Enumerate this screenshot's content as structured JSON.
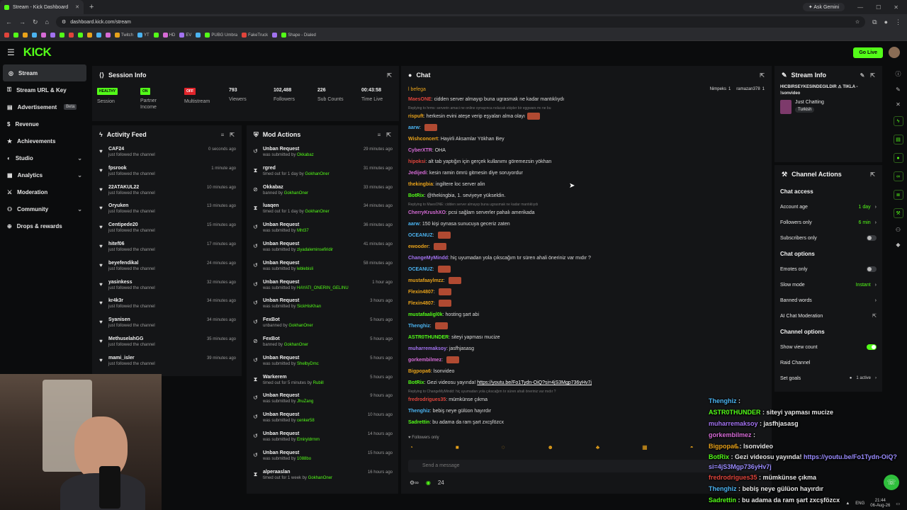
{
  "browser": {
    "tab_title": "Stream - Kick Dashboard",
    "new_tab": "+",
    "ask_gemini": "Ask Gemini",
    "url": "dashboard.kick.com/stream",
    "bookmarks": [
      "Twitch",
      "YT",
      "HD",
      "EV",
      "PUBG Umbra",
      "FakeTruck",
      "Shape - Dialed"
    ]
  },
  "header": {
    "logo": "KICK",
    "go_live": "Go Live"
  },
  "sidebar": {
    "items": [
      {
        "label": "Stream",
        "icon": "stream-icon",
        "active": true
      },
      {
        "label": "Stream URL & Key",
        "icon": "key-icon"
      },
      {
        "label": "Advertisement",
        "icon": "megaphone-icon",
        "badge": "Beta"
      },
      {
        "label": "Revenue",
        "icon": "dollar-icon"
      },
      {
        "label": "Achievements",
        "icon": "trophy-icon"
      },
      {
        "label": "Studio",
        "icon": "studio-icon",
        "expand": true
      },
      {
        "label": "Analytics",
        "icon": "chart-icon",
        "expand": true
      },
      {
        "label": "Moderation",
        "icon": "sword-icon"
      },
      {
        "label": "Community",
        "icon": "users-icon",
        "expand": true
      },
      {
        "label": "Drops & rewards",
        "icon": "gift-icon"
      }
    ]
  },
  "session": {
    "title": "Session Info",
    "stats": [
      {
        "badge": "HEALTHY",
        "label": "Session",
        "color": "#53fc18"
      },
      {
        "badge": "ON",
        "label": "Partner Income",
        "color": "#53fc18"
      },
      {
        "badge": "OFF",
        "label": "Multistream",
        "color": "#e0242b"
      },
      {
        "value": "793",
        "label": "Viewers"
      },
      {
        "value": "102,488",
        "label": "Followers"
      },
      {
        "value": "226",
        "label": "Sub Counts"
      },
      {
        "value": "00:43:58",
        "label": "Time Live"
      }
    ]
  },
  "activity": {
    "title": "Activity Feed",
    "items": [
      {
        "name": "CAF24",
        "sub": "just followed the channel",
        "time": "0 seconds ago"
      },
      {
        "name": "fpsrook",
        "sub": "just followed the channel",
        "time": "1 minute ago"
      },
      {
        "name": "22ATAKUL22",
        "sub": "just followed the channel",
        "time": "10 minutes ago"
      },
      {
        "name": "Oryuken",
        "sub": "just followed the channel",
        "time": "13 minutes ago"
      },
      {
        "name": "Centipede20",
        "sub": "just followed the channel",
        "time": "15 minutes ago"
      },
      {
        "name": "hitef06",
        "sub": "just followed the channel",
        "time": "17 minutes ago"
      },
      {
        "name": "beyefendikal",
        "sub": "just followed the channel",
        "time": "24 minutes ago"
      },
      {
        "name": "yasinkess",
        "sub": "just followed the channel",
        "time": "32 minutes ago"
      },
      {
        "name": "kr4k3r",
        "sub": "just followed the channel",
        "time": "34 minutes ago"
      },
      {
        "name": "Syanisen",
        "sub": "just followed the channel",
        "time": "34 minutes ago"
      },
      {
        "name": "MethuselahGG",
        "sub": "just followed the channel",
        "time": "35 minutes ago"
      },
      {
        "name": "mami_isler",
        "sub": "just followed the channel",
        "time": "39 minutes ago"
      }
    ]
  },
  "mod": {
    "title": "Mod Actions",
    "items": [
      {
        "icon": "↺",
        "name": "Unban Request",
        "pre": "was submitted by ",
        "by": "Okkabaz",
        "time": "29 minutes ago"
      },
      {
        "icon": "⧗",
        "name": "rgred",
        "pre": "timed out for 1 day by ",
        "by": "GokhanOner",
        "time": "31 minutes ago"
      },
      {
        "icon": "⊘",
        "name": "Okkabaz",
        "pre": "banned by ",
        "by": "GokhanOner",
        "time": "33 minutes ago"
      },
      {
        "icon": "⧗",
        "name": "luaqen",
        "pre": "timed out for 1 day by ",
        "by": "GokhanOner",
        "time": "34 minutes ago"
      },
      {
        "icon": "↺",
        "name": "Unban Request",
        "pre": "was submitted by ",
        "by": "Mht37",
        "time": "36 minutes ago"
      },
      {
        "icon": "↺",
        "name": "Unban Request",
        "pre": "was submitted by ",
        "by": "ziyadaleminsefiridir",
        "time": "41 minutes ago"
      },
      {
        "icon": "↺",
        "name": "Unban Request",
        "pre": "was submitted by ",
        "by": "leblebisli",
        "time": "58 minutes ago"
      },
      {
        "icon": "↺",
        "name": "Unban Request",
        "pre": "was submitted by ",
        "by": "HAYATI_ONERIN_GELINU",
        "time": "1 hour ago"
      },
      {
        "icon": "↺",
        "name": "Unban Request",
        "pre": "was submitted by ",
        "by": "SickHisKhan",
        "time": "3 hours ago"
      },
      {
        "icon": "↺",
        "name": "FexBot",
        "pre": "unbanned by ",
        "by": "GokhanOner",
        "time": "5 hours ago"
      },
      {
        "icon": "⊘",
        "name": "FexBot",
        "pre": "banned by ",
        "by": "GokhanOner",
        "time": "5 hours ago"
      },
      {
        "icon": "↺",
        "name": "Unban Request",
        "pre": "was submitted by ",
        "by": "ShelbyDmc",
        "time": "5 hours ago"
      },
      {
        "icon": "⧗",
        "name": "Warkerem",
        "pre": "timed out for 5 minutes by ",
        "by": "Rubill",
        "time": "5 hours ago"
      },
      {
        "icon": "↺",
        "name": "Unban Request",
        "pre": "was submitted by ",
        "by": "JhuZang",
        "time": "9 hours ago"
      },
      {
        "icon": "↺",
        "name": "Unban Request",
        "pre": "was submitted by ",
        "by": "cenker58",
        "time": "10 hours ago"
      },
      {
        "icon": "↺",
        "name": "Unban Request",
        "pre": "was submitted by ",
        "by": "Emiryldrmm",
        "time": "14 hours ago"
      },
      {
        "icon": "↺",
        "name": "Unban Request",
        "pre": "was submitted by ",
        "by": "1088bo",
        "time": "15 hours ago"
      },
      {
        "icon": "⧗",
        "name": "alperaaslan",
        "pre": "timed out for 1 week by ",
        "by": "GokhanOner",
        "time": "16 hours ago"
      }
    ]
  },
  "chat": {
    "title": "Chat",
    "pinned_user": "l befega",
    "top_users": [
      {
        "name": "Nimpeks",
        "n": "1"
      },
      {
        "name": "ramazan378",
        "n": "1"
      }
    ],
    "messages": [
      {
        "type": "msg",
        "user": "MaesONE",
        "color": "#e0443b",
        "text": "cidden server almayıp buna ugrasmak ne kadar mantıklıydı"
      },
      {
        "type": "reply",
        "text": "Replying to hrms: serverin amaci ne online oynayınca nolucak ekipler bir eggwars mı ne bu"
      },
      {
        "type": "msg",
        "user": "rispuft",
        "color": "#e8a21a",
        "text": "herkesin evini ateşe verip eşyaları alma olayı",
        "emote": true
      },
      {
        "type": "msg",
        "user": "aarw",
        "color": "#4bb3f0",
        "text": "",
        "emote": true
      },
      {
        "type": "msg",
        "user": "Wishconcert",
        "color": "#e8a21a",
        "text": "Hayirli Aksamlar Yökhan Bey"
      },
      {
        "type": "msg",
        "user": "CyberXTR",
        "color": "#d66bd6",
        "text": "OHA"
      },
      {
        "type": "msg",
        "user": "hipoksi",
        "color": "#e0443b",
        "text": "alt tab yaptığın için gerçek kullanımı göremezsin yökhan"
      },
      {
        "type": "msg",
        "user": "Jedijedi",
        "color": "#d66bd6",
        "text": "kesin ramin ömrü gitmesin diye soruyordur"
      },
      {
        "type": "msg",
        "user": "thekingbia",
        "color": "#e8a21a",
        "text": "ingiltere loc server alin"
      },
      {
        "type": "msg",
        "user": "BotRix",
        "color": "#53fc18",
        "text": "@thekingbia, 1. seviyeye yükseldin."
      },
      {
        "type": "reply",
        "text": "Replying to MaesONE: cidden server almayıp buna ugrasmak ne kadar mantıklıydı"
      },
      {
        "type": "msg",
        "user": "CherryKrushXO",
        "color": "#d66bd6",
        "text": "pcsi sağlam serverler pahalı amerikada"
      },
      {
        "type": "msg",
        "user": "aarw",
        "color": "#4bb3f0",
        "text": "150 kişi oynasa sunucuya geceriz zaten"
      },
      {
        "type": "msg",
        "user": "OCEANUZ",
        "color": "#4bb3f0",
        "text": "",
        "emote": true
      },
      {
        "type": "msg",
        "user": "ewooder",
        "color": "#e8a21a",
        "text": "",
        "emote": true
      },
      {
        "type": "msg",
        "user": "ChangeMyMindd",
        "color": "#a272f0",
        "text": "hiç uyumadan yola çıkscağım tır süren ahali öneriniz var mıdır ?"
      },
      {
        "type": "msg",
        "user": "OCEANUZ",
        "color": "#4bb3f0",
        "text": "",
        "emote": true
      },
      {
        "type": "msg",
        "user": "mustafaaylmzz",
        "color": "#e8a21a",
        "text": "",
        "emote": true
      },
      {
        "type": "msg",
        "user": "Flexin4807",
        "color": "#e8a21a",
        "text": "",
        "emote": true
      },
      {
        "type": "msg",
        "user": "Flexin4807",
        "color": "#e8a21a",
        "text": "",
        "emote": true
      },
      {
        "type": "msg",
        "user": "mustafaaligl0k",
        "color": "#53fc18",
        "text": "hosting şart abi"
      },
      {
        "type": "msg",
        "user": "Thenghiz",
        "color": "#4bb3f0",
        "text": "",
        "emote": true
      },
      {
        "type": "msg",
        "user": "ASTR0THUNDER",
        "color": "#53fc18",
        "text": "siteyi yapması mucize"
      },
      {
        "type": "msg",
        "user": "muharremaksoy",
        "color": "#a272f0",
        "text": "jasfhjasasg"
      },
      {
        "type": "msg",
        "user": "gorkembilmez",
        "color": "#d66bd6",
        "text": "",
        "emote": true
      },
      {
        "type": "msg",
        "user": "Bigpopa6",
        "color": "#e8a21a",
        "text": "lsonvideo"
      },
      {
        "type": "msg",
        "user": "BotRix",
        "color": "#53fc18",
        "text": "Gezi videosu yayında!",
        "link": "https://youtu.be/Fo1Tydn-OiQ?si=4jS3Mgp736yHv7j"
      },
      {
        "type": "reply",
        "text": "Replying to ChangeMyMindd: hiç uyumadan yola çıkscağım tır süren ahali öneriniz var mıdır ?"
      },
      {
        "type": "msg",
        "user": "fredrodrigues35",
        "color": "#e0443b",
        "text": "mümkünse çıkma"
      },
      {
        "type": "msg",
        "user": "Thenghiz",
        "color": "#4bb3f0",
        "text": "bebiş neye gülüon hayırdır"
      },
      {
        "type": "msg",
        "user": "Sadrettin",
        "color": "#53fc18",
        "text": "bu adama da ram şart zxcşfözcx"
      }
    ],
    "followers_only": "Followers only",
    "placeholder": "Send a message",
    "viewers": "24"
  },
  "stream_info": {
    "title": "Stream Info",
    "stream_title": "HICBIRSEYKESINDEGILDIR ⚠ TIKLA - !sonvideo",
    "category": "Just Chatting",
    "tag": "Turkish"
  },
  "channel_actions": {
    "title": "Channel Actions",
    "chat_access": "Chat access",
    "account_age": {
      "label": "Account age",
      "value": "1 day"
    },
    "followers_only": {
      "label": "Followers only",
      "value": "6 min"
    },
    "subscribers_only": "Subscribers only",
    "chat_options": "Chat options",
    "emotes_only": "Emotes only",
    "slow_mode": {
      "label": "Slow mode",
      "value": "Instant"
    },
    "banned_words": "Banned words",
    "ai_moderation": "AI Chat Moderation",
    "channel_options": "Channel options",
    "show_view_count": "Show view count",
    "raid_channel": "Raid Channel",
    "set_goals": {
      "label": "Set goals",
      "value": "1 active"
    }
  },
  "overlay": [
    {
      "user": "Thenghiz",
      "color": "#4bb3f0",
      "text": ""
    },
    {
      "user": "ASTR0THUNDER",
      "color": "#53fc18",
      "text": "siteyi yapması mucize"
    },
    {
      "user": "muharremaksoy",
      "color": "#a272f0",
      "text": "jasfhjasasg"
    },
    {
      "user": "gorkembilmez",
      "color": "#d66bd6",
      "text": ""
    },
    {
      "user": "Bigpopa6",
      "color": "#e8a21a",
      "text": "lsonvideo"
    },
    {
      "user": "BotRix",
      "color": "#53fc18",
      "text": "Gezi videosu yayında!",
      "link": "https://youtu.be/Fo1Tydn-OiQ?si=4jS3Mgp736yHv7j"
    },
    {
      "user": "fredrodrigues35",
      "color": "#e0443b",
      "text": "mümkünse çıkma"
    },
    {
      "user": "Thenghiz",
      "color": "#4bb3f0",
      "text": "bebiş neye gülüon hayırdır"
    },
    {
      "user": "Sadrettin",
      "color": "#53fc18",
      "text": "bu adama da ram şart zxcşfözcx"
    }
  ],
  "taskbar": {
    "lang": "ENG",
    "time": "21:44",
    "date": "06-Aug-26"
  }
}
